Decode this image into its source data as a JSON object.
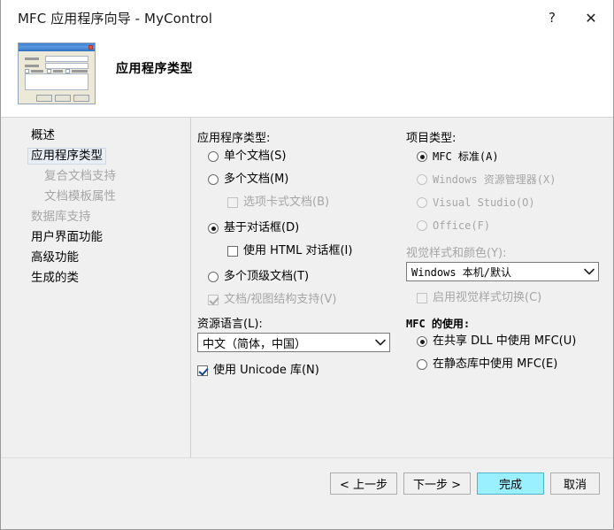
{
  "window": {
    "title": "MFC 应用程序向导 - MyControl",
    "help_label": "?",
    "close_label": "✕"
  },
  "header": {
    "page_title": "应用程序类型",
    "preview_name": "dialog-preview-image"
  },
  "sidebar": {
    "items": [
      {
        "label": "概述",
        "state": "normal",
        "indent": false
      },
      {
        "label": "应用程序类型",
        "state": "selected",
        "indent": false
      },
      {
        "label": "复合文档支持",
        "state": "disabled",
        "indent": true
      },
      {
        "label": "文档模板属性",
        "state": "disabled",
        "indent": true
      },
      {
        "label": "数据库支持",
        "state": "disabled",
        "indent": false
      },
      {
        "label": "用户界面功能",
        "state": "normal",
        "indent": false
      },
      {
        "label": "高级功能",
        "state": "normal",
        "indent": false
      },
      {
        "label": "生成的类",
        "state": "normal",
        "indent": false
      }
    ]
  },
  "app_type": {
    "group_label": "应用程序类型:",
    "options": [
      {
        "label": "单个文档(S)",
        "type": "radio",
        "checked": false,
        "enabled": true
      },
      {
        "label": "多个文档(M)",
        "type": "radio",
        "checked": false,
        "enabled": true
      },
      {
        "label": "选项卡式文档(B)",
        "type": "checkbox",
        "checked": false,
        "enabled": false
      },
      {
        "label": "基于对话框(D)",
        "type": "radio",
        "checked": true,
        "enabled": true
      },
      {
        "label": "使用 HTML 对话框(I)",
        "type": "checkbox",
        "checked": false,
        "enabled": true
      },
      {
        "label": "多个顶级文档(T)",
        "type": "radio",
        "checked": false,
        "enabled": true
      },
      {
        "label": "文档/视图结构支持(V)",
        "type": "checkbox",
        "checked": true,
        "enabled": false
      }
    ]
  },
  "resource_language": {
    "label": "资源语言(L):",
    "value": "中文（简体，中国）",
    "arrow": "⌄"
  },
  "unicode": {
    "label": "使用 Unicode 库(N)",
    "checked": true
  },
  "project_type": {
    "group_label": "项目类型:",
    "options": [
      {
        "label": "MFC 标准(A)",
        "checked": true,
        "enabled": true
      },
      {
        "label": "Windows 资源管理器(X)",
        "checked": false,
        "enabled": false
      },
      {
        "label": "Visual Studio(O)",
        "checked": false,
        "enabled": false
      },
      {
        "label": "Office(F)",
        "checked": false,
        "enabled": false
      }
    ]
  },
  "visual_style": {
    "label": "视觉样式和颜色(Y):",
    "value": "Windows 本机/默认",
    "arrow": "⌄",
    "toggle_label": "启用视觉样式切换(C)",
    "toggle_checked": false
  },
  "mfc_usage": {
    "group_label": "MFC 的使用:",
    "options": [
      {
        "label": "在共享 DLL 中使用 MFC(U)",
        "checked": true
      },
      {
        "label": "在静态库中使用 MFC(E)",
        "checked": false
      }
    ]
  },
  "footer": {
    "back": "< 上一步",
    "next": "下一步 >",
    "finish": "完成",
    "cancel": "取消"
  },
  "colors": {
    "body_bg": "#f0f0f0",
    "header_bg": "#ffffff",
    "selected_nav_bg": "#e9eff7",
    "primary_btn_bg": "#9af0ff",
    "disabled_text": "#a6a6a6"
  }
}
